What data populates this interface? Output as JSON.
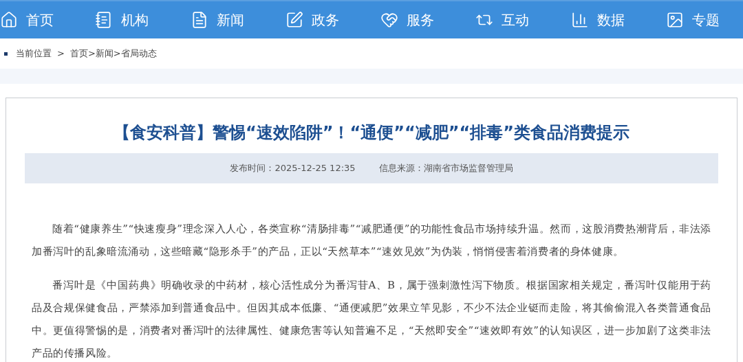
{
  "nav": [
    {
      "label": "首页"
    },
    {
      "label": "机构"
    },
    {
      "label": "新闻"
    },
    {
      "label": "政务"
    },
    {
      "label": "服务"
    },
    {
      "label": "互动"
    },
    {
      "label": "数据"
    },
    {
      "label": "专题"
    }
  ],
  "breadcrumb": {
    "label": "当前位置",
    "separator": ">",
    "path": "首页>新闻>省局动态"
  },
  "article": {
    "title": "【食安科普】警惕“速效陷阱”！“通便”“减肥”“排毒”类食品消费提示",
    "published": "发布时间：2025-12-25 12:35",
    "source": "信息来源：湖南省市场监督管理局",
    "paragraphs": [
      "随着“健康养生”“快速瘦身”理念深入人心，各类宣称“清肠排毒”“减肥通便”的功能性食品市场持续升温。然而，这股消费热潮背后，非法添加番泻叶的乱象暗流涌动，这些暗藏“隐形杀手”的产品，正以“天然草本”“速效见效”为伪装，悄悄侵害着消费者的身体健康。",
      "番泻叶是《中国药典》明确收录的中药材，核心活性成分为番泻苷A、B，属于强刺激性泻下物质。根据国家相关规定，番泻叶仅能用于药品及合规保健食品，严禁添加到普通食品中。但因其成本低廉、“通便减肥”效果立竿见影，不少不法企业铤而走险，将其偷偷混入各类普通食品中。更值得警惕的是，消费者对番泻叶的法律属性、健康危害等认知普遍不足，“天然即安全”“速效即有效”的认知误区，进一步加剧了这类非法产品的传播风险。"
    ]
  }
}
